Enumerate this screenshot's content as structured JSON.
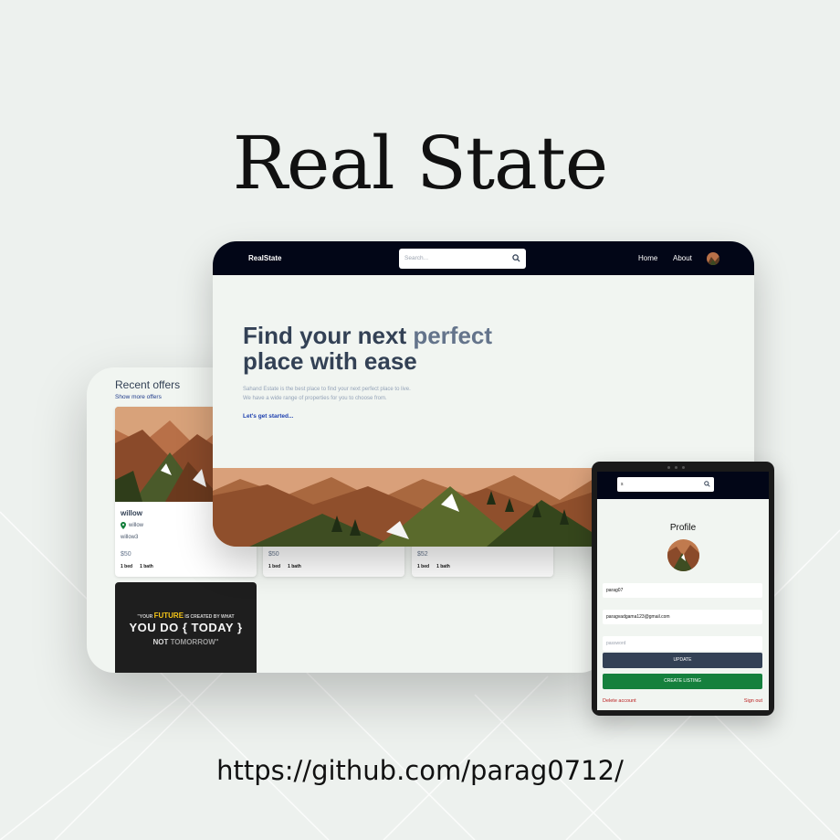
{
  "poster": {
    "title": "Real State",
    "link": "https://github.com/parag0712/"
  },
  "listings_panel": {
    "heading": "Recent offers",
    "show_more": "Show more offers",
    "cards": [
      {
        "name": "willow",
        "location": "willow",
        "description": "willow3",
        "price": "$50",
        "beds": "1 bed",
        "baths": "1 bath"
      },
      {
        "price": "$50",
        "beds": "1 bed",
        "baths": "1 bath"
      },
      {
        "price": "$52",
        "beds": "1 bed",
        "baths": "1 bath"
      }
    ],
    "quote": {
      "line1_a": "\"YOUR ",
      "line1_hl": "FUTURE",
      "line1_b": " IS CREATED BY WHAT",
      "line2": "YOU DO { TODAY }",
      "line3_a": "NOT ",
      "line3_b": "TOMORROW\""
    }
  },
  "desktop": {
    "brand": "RealState",
    "search_placeholder": "Search...",
    "nav": {
      "home": "Home",
      "about": "About"
    },
    "hero": {
      "title_a": "Find your next ",
      "title_accent": "perfect",
      "title_b": "place with ease",
      "sub_line1": "Sahand Estate is the best place to find your next perfect place to live.",
      "sub_line2": "We have a wide range of properties for you to choose from.",
      "cta": "Let's get started..."
    }
  },
  "tablet": {
    "search_value": "s",
    "title": "Profile",
    "username": "parag07",
    "email": "paragvadgama123@gmail.com",
    "password_placeholder": "password",
    "update": "UPDATE",
    "create_listing": "CREATE LISTING",
    "delete_account": "Delete account",
    "sign_out": "Sign out"
  },
  "colors": {
    "background": "#edf1ee",
    "navbar": "#020617",
    "heading": "#334155",
    "accent": "#64748b",
    "link": "#1e40af",
    "create_button": "#15803d",
    "danger": "#b91c1c"
  }
}
